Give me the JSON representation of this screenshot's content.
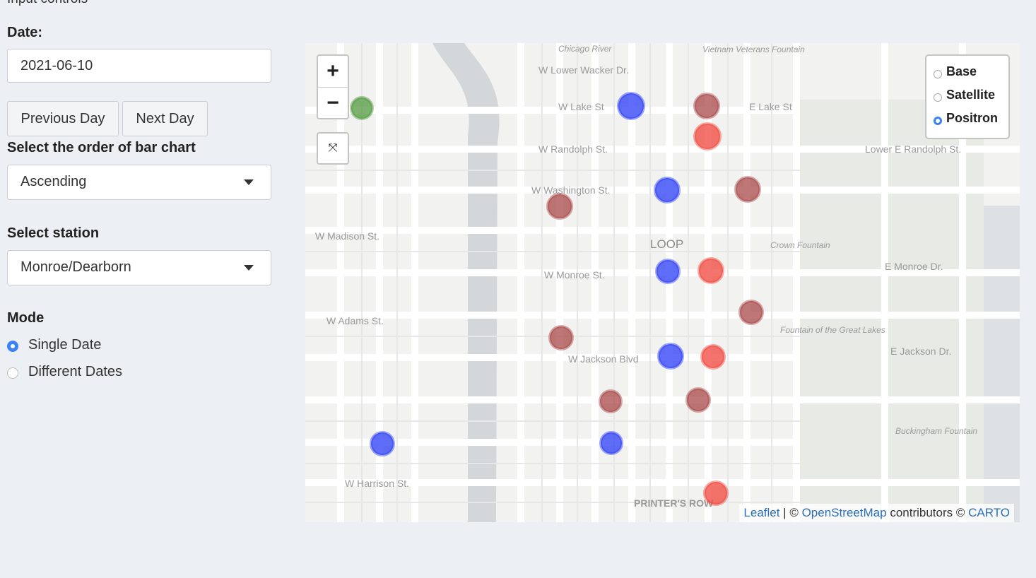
{
  "panel": {
    "section_title": "Input controls",
    "date_label": "Date:",
    "date_value": "2021-06-10",
    "prev_label": "Previous Day",
    "next_label": "Next Day",
    "order_label": "Select the order of bar chart",
    "order_value": "Ascending",
    "station_label": "Select station",
    "station_value": "Monroe/Dearborn",
    "mode_label": "Mode",
    "mode_options": [
      "Single Date",
      "Different Dates"
    ],
    "mode_selected": "Single Date"
  },
  "map": {
    "zoom_in": "+",
    "zoom_out": "−",
    "layers": [
      {
        "label": "Base",
        "selected": false
      },
      {
        "label": "Satellite",
        "selected": false
      },
      {
        "label": "Positron",
        "selected": true
      }
    ],
    "attribution": {
      "leaflet": "Leaflet",
      "sep1": " | © ",
      "osm": "OpenStreetMap",
      "mid": " contributors © ",
      "carto": "CARTO"
    },
    "colors": {
      "blue": "#2b3cf5",
      "red": "#f0463c",
      "darkred": "#a84848",
      "green": "#4f9a3f"
    },
    "street_labels": [
      "W Lower Wacker Dr.",
      "W Lake St",
      "E Lake St",
      "W Randolph St.",
      "Lower E Randolph St.",
      "W Washington St.",
      "W Madison St.",
      "LOOP",
      "Crown Fountain",
      "W Monroe St.",
      "E Monroe Dr.",
      "W Adams St.",
      "W Jackson Blvd",
      "E Jackson Dr.",
      "W Harrison St.",
      "PRINTER'S ROW",
      "Buckingham Fountain",
      "Fountain of the Great Lakes",
      "Vietnam Veterans Fountain",
      "Chicago River"
    ]
  }
}
